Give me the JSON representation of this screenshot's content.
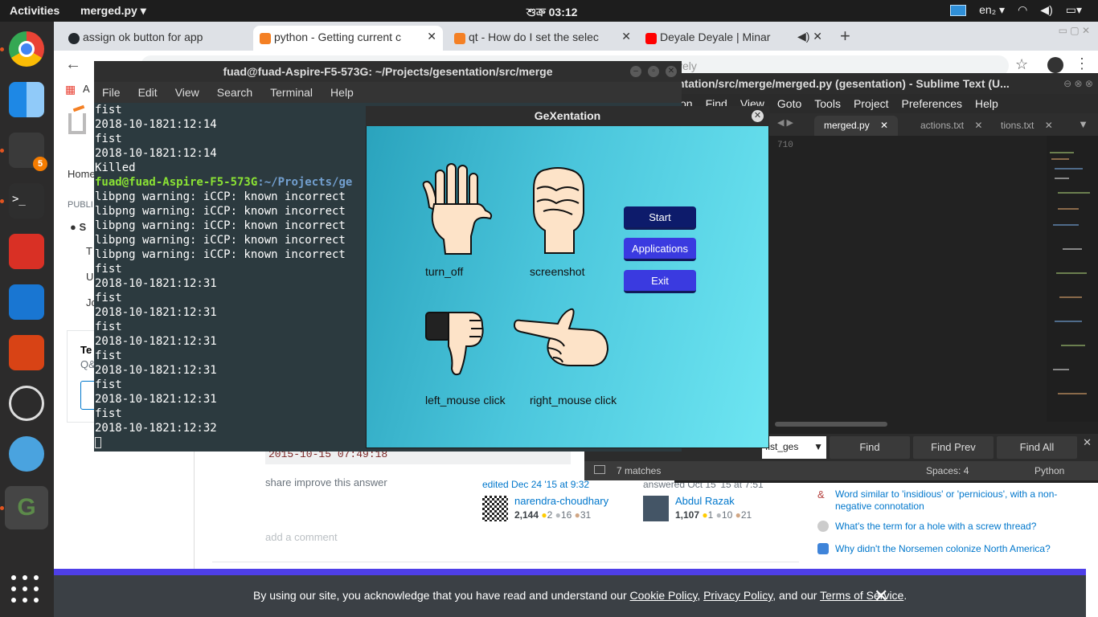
{
  "topbar": {
    "activities": "Activities",
    "app_name": "merged.py ▾",
    "clock": "শুক্র 03:12",
    "lang": "en₂ ▾"
  },
  "browser": {
    "tabs": [
      {
        "label": "assign ok button for app",
        "color": "#24292e"
      },
      {
        "label": "python - Getting current c",
        "color": "#f48024"
      },
      {
        "label": "qt - How do I set the selec",
        "color": "#f48024"
      },
      {
        "label": "Deyale Deyale | Minar",
        "color": "#ff0000"
      }
    ],
    "url": "tively",
    "new_tab": "+"
  },
  "so": {
    "nav_home": "Home",
    "nav_public": "PUBLI",
    "nav_items": [
      "S",
      "T",
      "U",
      "Jo"
    ],
    "teams_title": "Te",
    "teams_sub": "Q&",
    "code_text": "2015-10-15 07:49:18",
    "share": "share  improve this answer",
    "edited": "edited Dec 24 '15 at 9:32",
    "answered": "answered Oct 15 '15 at 7:51",
    "user1": {
      "name": "narendra-choudhary",
      "rep": "2,144",
      "gold": "2",
      "silver": "16",
      "bronze": "31"
    },
    "user2": {
      "name": "Abdul Razak",
      "rep": "1,107",
      "gold": "1",
      "silver": "10",
      "bronze": "21"
    },
    "add_comment": "add a comment",
    "hot": [
      "Word similar to 'insidious' or 'pernicious', with a non-negative connotation",
      "What's the term for a hole with a screw thread?",
      "Why didn't the Norsemen colonize North America?"
    ],
    "cookie": {
      "pre": "By using our site, you acknowledge that you have read and understand our ",
      "cookie_policy": "Cookie Policy",
      "sep1": ", ",
      "privacy": "Privacy Policy",
      "sep2": ", and our ",
      "terms": "Terms of Service",
      "end": ".",
      "close": "✕"
    }
  },
  "sublime": {
    "title": "ntation/src/merge/merged.py (gesentation) - Sublime Text (U...",
    "menu": [
      "tion",
      "Find",
      "View",
      "Goto",
      "Tools",
      "Project",
      "Preferences",
      "Help"
    ],
    "tabs": [
      "merged.py",
      "actions.txt",
      "tions.txt"
    ],
    "line_number": "710",
    "find_value": "fist_ges",
    "find_buttons": [
      "Find",
      "Find Prev",
      "Find All"
    ],
    "matches": "7 matches",
    "spaces": "Spaces: 4",
    "syntax": "Python"
  },
  "terminal": {
    "title": "fuad@fuad-Aspire-F5-573G: ~/Projects/gesentation/src/merge",
    "menu": [
      "File",
      "Edit",
      "View",
      "Search",
      "Terminal",
      "Help"
    ],
    "lines_before": [
      "fist",
      "2018-10-1821:12:14",
      "fist",
      "2018-10-1821:12:14",
      "Killed"
    ],
    "prompt_user": "fuad@fuad-Aspire-F5-573G",
    "prompt_path": ":~/Projects/ge",
    "warnings": [
      "libpng warning: iCCP: known incorrect",
      "libpng warning: iCCP: known incorrect",
      "libpng warning: iCCP: known incorrect",
      "libpng warning: iCCP: known incorrect",
      "libpng warning: iCCP: known incorrect"
    ],
    "lines_after": [
      "fist",
      "2018-10-1821:12:31",
      "fist",
      "2018-10-1821:12:31",
      "fist",
      "2018-10-1821:12:31",
      "fist",
      "2018-10-1821:12:31",
      "fist",
      "2018-10-1821:12:31",
      "fist",
      "2018-10-1821:12:32"
    ]
  },
  "gex": {
    "title": "GeXentation",
    "gestures": [
      "turn_off",
      "screenshot",
      "left_mouse click",
      "right_mouse click"
    ],
    "buttons": [
      {
        "label": "Start",
        "color": "#0d1b6b"
      },
      {
        "label": "Applications",
        "color": "#3a3ae0"
      },
      {
        "label": "Exit",
        "color": "#3a3ae0"
      }
    ]
  }
}
